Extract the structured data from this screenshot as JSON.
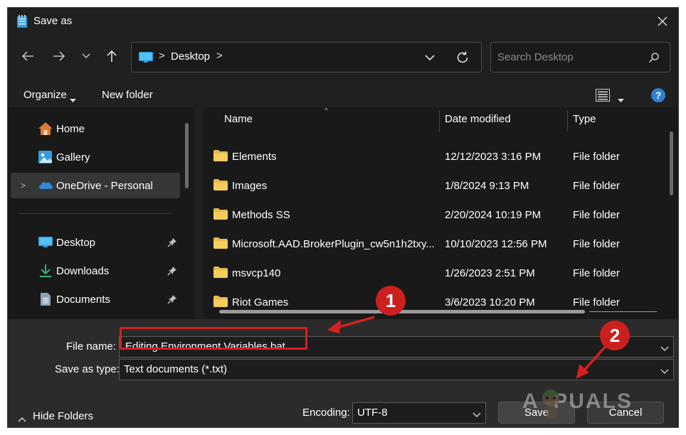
{
  "window": {
    "title": "Save as",
    "icons": {
      "title": "notepad-icon",
      "close": "close-icon"
    }
  },
  "navigation": {
    "back_icon": "back-arrow-icon",
    "forward_icon": "forward-arrow-icon",
    "recent_icon": "chevron-down-icon",
    "up_icon": "up-arrow-icon",
    "address": {
      "icon": "desktop-icon",
      "separator": ">",
      "location": "Desktop",
      "trailing_separator": ">"
    },
    "search": {
      "placeholder": "Search Desktop",
      "value": ""
    }
  },
  "toolbar": {
    "organize_label": "Organize",
    "new_folder_label": "New folder",
    "view_icon": "view-options-icon",
    "help_label": "?"
  },
  "sidebar": {
    "items": [
      {
        "label": "Home",
        "icon": "home-icon"
      },
      {
        "label": "Gallery",
        "icon": "gallery-icon"
      },
      {
        "label": "OneDrive - Personal",
        "icon": "onedrive-icon",
        "expand": ">",
        "selected": true
      },
      {
        "label": "Desktop",
        "icon": "desktop-icon",
        "pinned": true
      },
      {
        "label": "Downloads",
        "icon": "download-icon",
        "pinned": true
      },
      {
        "label": "Documents",
        "icon": "documents-icon",
        "pinned": true
      }
    ]
  },
  "file_list": {
    "columns": [
      "Name",
      "Date modified",
      "Type"
    ],
    "sort_indicator": "^",
    "rows": [
      {
        "name": "Elements",
        "date": "12/12/2023 3:16 PM",
        "type": "File folder"
      },
      {
        "name": "Images",
        "date": "1/8/2024 9:13 PM",
        "type": "File folder"
      },
      {
        "name": "Methods SS",
        "date": "2/20/2024 10:19 PM",
        "type": "File folder"
      },
      {
        "name": "Microsoft.AAD.BrokerPlugin_cw5n1h2txy...",
        "date": "10/10/2023 12:56 PM",
        "type": "File folder"
      },
      {
        "name": "msvcp140",
        "date": "1/26/2023 2:51 PM",
        "type": "File folder"
      },
      {
        "name": "Riot Games",
        "date": "3/6/2023 10:20 PM",
        "type": "File folder"
      }
    ]
  },
  "form": {
    "file_name_label": "File name:",
    "file_name_value": "Editing Environment Variables.bat",
    "save_type_label": "Save as type:",
    "save_type_value": "Text documents (*.txt)",
    "encoding_label": "Encoding:",
    "encoding_value": "UTF-8",
    "hide_folders_label": "Hide Folders",
    "save_label": "Save",
    "cancel_label": "Cancel"
  },
  "annotations": {
    "step1": "1",
    "step2": "2",
    "color": "#cc1f1f"
  },
  "watermark": {
    "text": "A  PUALS"
  },
  "colors": {
    "dialog_bg": "#202020",
    "pane_bg": "#191919",
    "bottom_bg": "#2b2b2b",
    "folder": "#e8b84a",
    "accent": "#2f7fd0"
  }
}
